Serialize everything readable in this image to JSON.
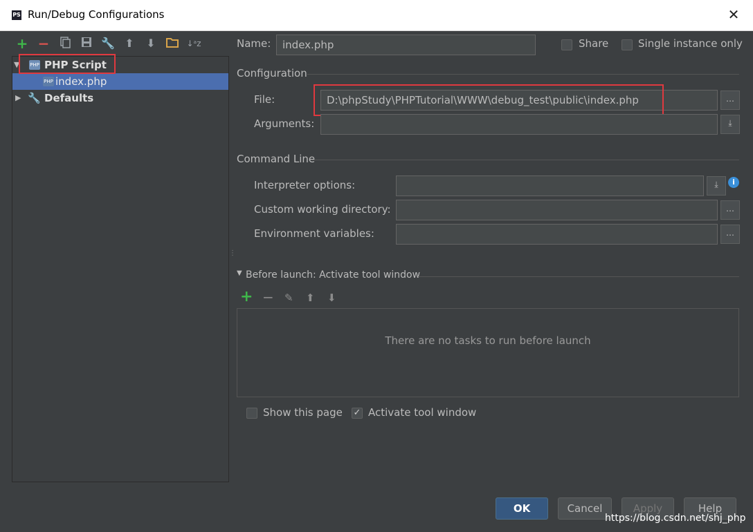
{
  "window": {
    "title": "Run/Debug Configurations",
    "app_badge": "PS"
  },
  "toolbar": [
    "add-icon",
    "remove-icon",
    "copy-icon",
    "save-icon",
    "wrench-icon",
    "arrow-up-icon",
    "arrow-down-icon",
    "folder-icon",
    "sort-az-icon"
  ],
  "tree": {
    "group": "PHP Script",
    "child": "index.php",
    "defaults": "Defaults"
  },
  "name_row": {
    "label": "Name:",
    "value": "index.php",
    "share": "Share",
    "single_instance": "Single instance only"
  },
  "configuration": {
    "header": "Configuration",
    "file_label": "File:",
    "file_value": "D:\\phpStudy\\PHPTutorial\\WWW\\debug_test\\public\\index.php",
    "arguments_label": "Arguments:",
    "arguments_value": ""
  },
  "command_line": {
    "header": "Command Line",
    "interpreter_label": "Interpreter options:",
    "working_dir_label": "Custom working directory:",
    "env_label": "Environment variables:"
  },
  "before_launch": {
    "header": "Before launch: Activate tool window",
    "empty_text": "There are no tasks to run before launch",
    "show_page": "Show this page",
    "activate_tool_window": "Activate tool window"
  },
  "buttons": {
    "ok": "OK",
    "cancel": "Cancel",
    "apply": "Apply",
    "help": "Help"
  },
  "watermark": "https://blog.csdn.net/shj_php",
  "colors": {
    "accent_red": "#e0393f",
    "selection": "#4b6eaf",
    "add_green": "#3fb64a",
    "remove_red": "#d9534f"
  }
}
